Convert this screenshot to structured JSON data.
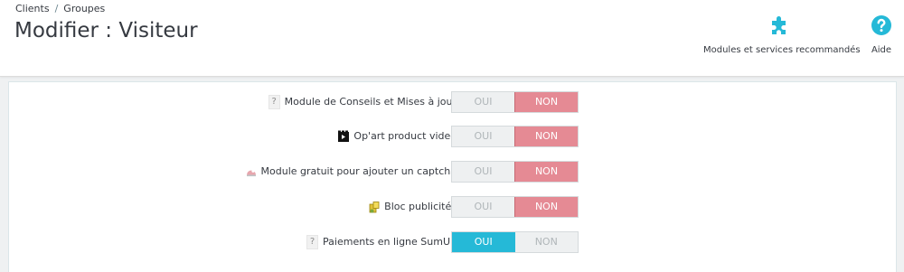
{
  "breadcrumb": {
    "items": [
      "Clients",
      "Groupes"
    ],
    "separator": "/"
  },
  "page_title": "Modifier : Visiteur",
  "toolbar": {
    "modules_label": "Modules et services recommandés",
    "help_label": "Aide",
    "accent_color": "#25b9d7"
  },
  "modules": [
    {
      "label": "Module de Conseils et Mises à jour",
      "icon": "question-icon",
      "oui": "OUI",
      "non": "NON",
      "state": "NON"
    },
    {
      "label": "Op'art product video",
      "icon": "video-icon",
      "oui": "OUI",
      "non": "NON",
      "state": "NON"
    },
    {
      "label": "Module gratuit pour ajouter un captcha",
      "icon": "captcha-icon",
      "oui": "OUI",
      "non": "NON",
      "state": "NON"
    },
    {
      "label": "Bloc publicités",
      "icon": "ads-icon",
      "oui": "OUI",
      "non": "NON",
      "state": "NON"
    },
    {
      "label": "Paiements en ligne SumUp",
      "icon": "question-icon",
      "oui": "OUI",
      "non": "NON",
      "state": "OUI"
    }
  ],
  "colors": {
    "non_active": "#e58a94",
    "oui_active": "#25b9d7"
  }
}
